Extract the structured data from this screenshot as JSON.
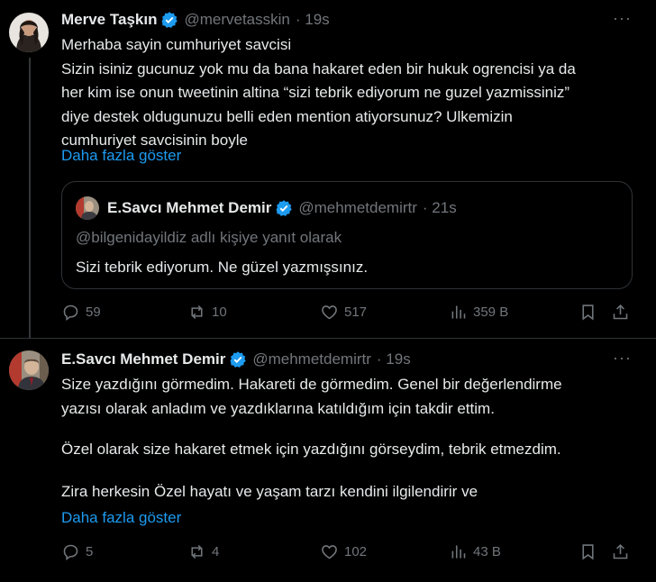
{
  "tweet1": {
    "name": "Merve Taşkın",
    "handle": "@mervetasskin",
    "time": "· 19s",
    "more": "···",
    "lines": [
      "Merhaba sayin cumhuriyet savcisi",
      "Sizin isiniz gucunuz yok mu da bana hakaret eden bir hukuk ogrencisi ya da",
      "her kim ise onun tweetinin altina “sizi tebrik ediyorum ne guzel yazmissiniz”",
      "diye destek oldugunuzu belli eden mention atiyorsunuz? Ulkemizin",
      "cumhuriyet savcisinin boyle"
    ],
    "show_more": "Daha fazla göster",
    "quote": {
      "name": "E.Savcı Mehmet Demir",
      "handle": "@mehmetdemirtr",
      "time": "· 21s",
      "reply_to": "@bilgenidayildiz adlı kişiye yanıt olarak",
      "text": "Sizi tebrik ediyorum. Ne güzel yazmışsınız."
    },
    "actions": {
      "replies": "59",
      "reposts": "10",
      "likes": "517",
      "views": "359 B"
    }
  },
  "tweet2": {
    "name": "E.Savcı Mehmet Demir",
    "handle": "@mehmetdemirtr",
    "time": "· 19s",
    "more": "···",
    "lines": [
      "Size yazdığını görmedim. Hakareti de görmedim. Genel bir değerlendirme",
      "yazısı olarak anladım ve yazdıklarına katıldığım için takdir ettim.",
      "",
      "Özel olarak size hakaret etmek için yazdığını görseydim, tebrik etmezdim.",
      "",
      "Zira herkesin Özel hayatı ve yaşam tarzı kendini ilgilendirir ve"
    ],
    "show_more": "Daha fazla göster",
    "actions": {
      "replies": "5",
      "reposts": "4",
      "likes": "102",
      "views": "43 B"
    }
  },
  "colors": {
    "accent": "#1d9bf0",
    "muted": "#71767b",
    "text": "#e7e9ea",
    "border": "#2f3336"
  }
}
